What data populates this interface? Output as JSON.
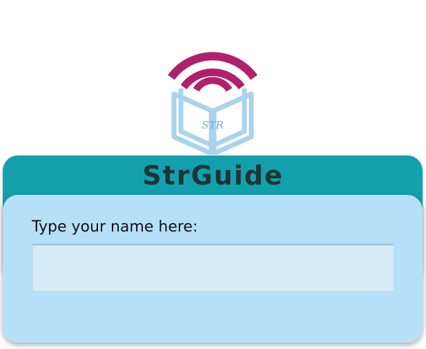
{
  "app": {
    "title": "StrGuide"
  },
  "logo": {
    "icon": "book-wifi-icon",
    "initials": "STR",
    "colors": {
      "signal": "#b0206b",
      "book": "#a9d3ee",
      "initials": "#7fa9c6"
    }
  },
  "form": {
    "name_label": "Type your name here:",
    "name_value": "",
    "name_placeholder": ""
  },
  "colors": {
    "header": "#13a0ad",
    "panel": "#b6e0f8",
    "input": "#d6ebf8",
    "title_text": "#1f3436"
  }
}
